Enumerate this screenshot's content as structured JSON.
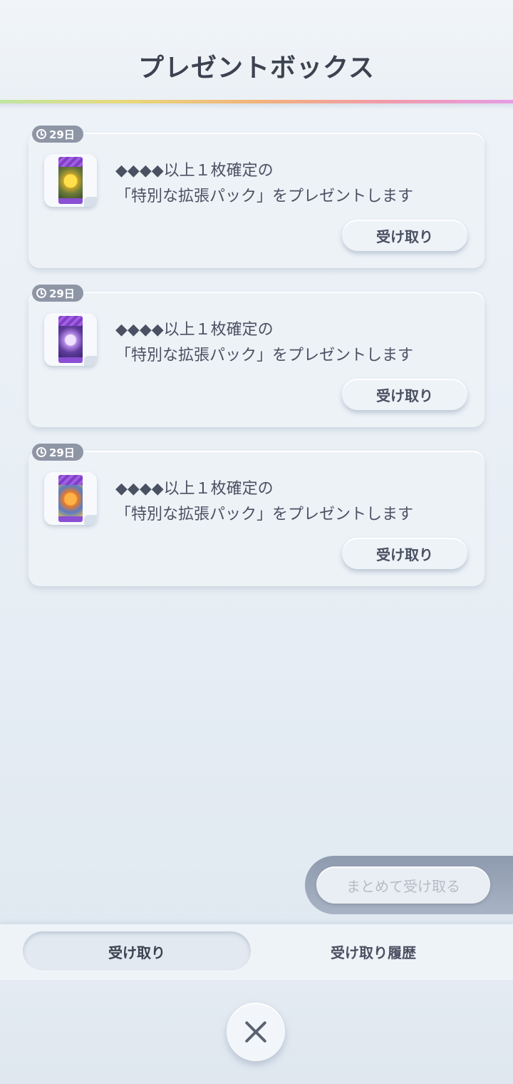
{
  "header": {
    "title": "プレゼントボックス"
  },
  "gifts": [
    {
      "timer": "29日",
      "pack_art": "pikachu-pack-icon",
      "line1": "◆◆◆◆以上１枚確定の",
      "line2": "「特別な拡張パック」をプレゼントします",
      "button": "受け取り"
    },
    {
      "timer": "29日",
      "pack_art": "mewtwo-pack-icon",
      "line1": "◆◆◆◆以上１枚確定の",
      "line2": "「特別な拡張パック」をプレゼントします",
      "button": "受け取り"
    },
    {
      "timer": "29日",
      "pack_art": "charizard-pack-icon",
      "line1": "◆◆◆◆以上１枚確定の",
      "line2": "「特別な拡張パック」をプレゼントします",
      "button": "受け取り"
    }
  ],
  "bulk_button": {
    "label": "まとめて受け取る",
    "state": "disabled"
  },
  "tabs": [
    {
      "label": "受け取り",
      "active": true
    },
    {
      "label": "受け取り履歴",
      "active": false
    }
  ],
  "close_button": {
    "icon": "close-icon"
  },
  "colors": {
    "background": "#e9eff5",
    "text": "#4a5162",
    "timer_badge": "#8e96a6",
    "pack_purple": "#8a4fd4"
  }
}
